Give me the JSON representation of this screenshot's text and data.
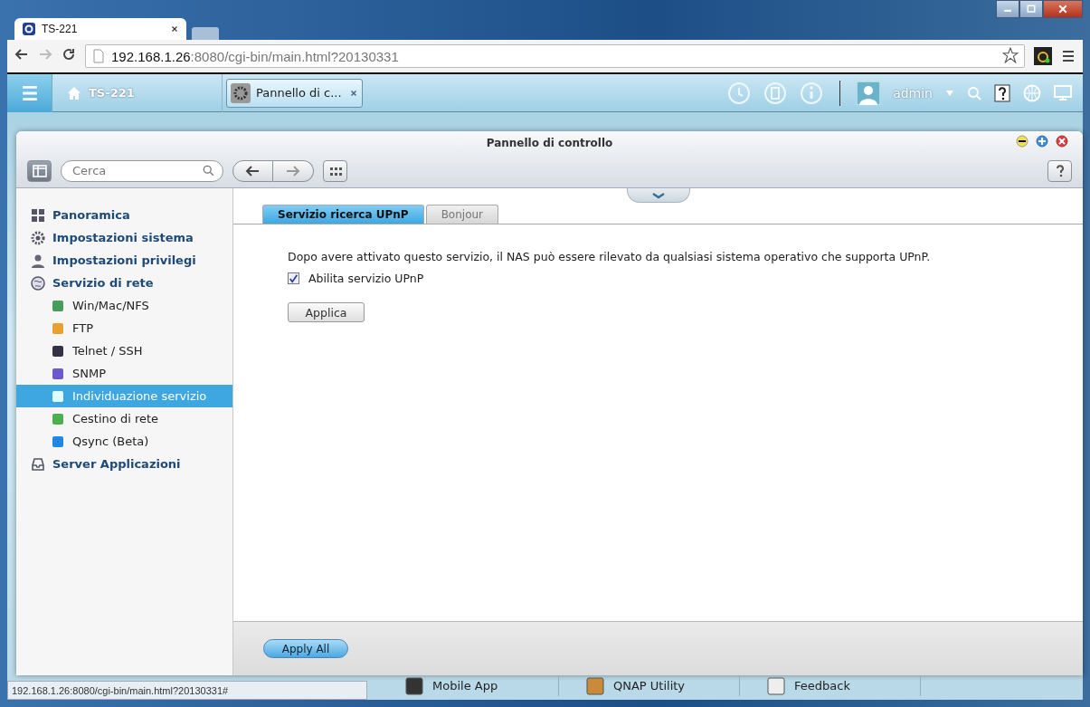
{
  "browser": {
    "tabs": [
      {
        "title": "TS-221",
        "selected": true
      }
    ],
    "address": {
      "host": "192.168.1.26",
      "rest": ":8080/cgi-bin/main.html?20130331"
    }
  },
  "topbar": {
    "home": "TS-221",
    "app_tab": "Pannello di c...",
    "user": "admin"
  },
  "window": {
    "title": "Pannello di controllo",
    "search": {
      "placeholder": "Cerca"
    }
  },
  "sidebar": {
    "items": [
      {
        "label": "Panoramica",
        "selected": false
      },
      {
        "label": "Impostazioni sistema",
        "selected": false
      },
      {
        "label": "Impostazioni privilegi",
        "selected": false
      },
      {
        "label": "Servizio di rete",
        "selected": false,
        "children": [
          {
            "label": "Win/Mac/NFS",
            "selected": false
          },
          {
            "label": "FTP",
            "selected": false
          },
          {
            "label": "Telnet / SSH",
            "selected": false
          },
          {
            "label": "SNMP",
            "selected": false
          },
          {
            "label": "Individuazione servizio",
            "selected": true
          },
          {
            "label": "Cestino di rete",
            "selected": false
          },
          {
            "label": "Qsync (Beta)",
            "selected": false
          }
        ]
      },
      {
        "label": "Server Applicazioni",
        "selected": false
      }
    ]
  },
  "tabs": [
    {
      "label": "Servizio ricerca UPnP",
      "selected": true
    },
    {
      "label": "Bonjour",
      "selected": false
    }
  ],
  "description": "Dopo avere attivato questo servizio, il NAS può essere rilevato da qualsiasi sistema operativo che supporta UPnP.",
  "checkbox": {
    "label": "Abilita servizio UPnP",
    "checked": true
  },
  "apply": "Applica",
  "apply_all": "Apply All",
  "dock": [
    "Mobile App",
    "QNAP Utility",
    "Feedback"
  ],
  "status_url": "192.168.1.26:8080/cgi-bin/main.html?20130331#"
}
